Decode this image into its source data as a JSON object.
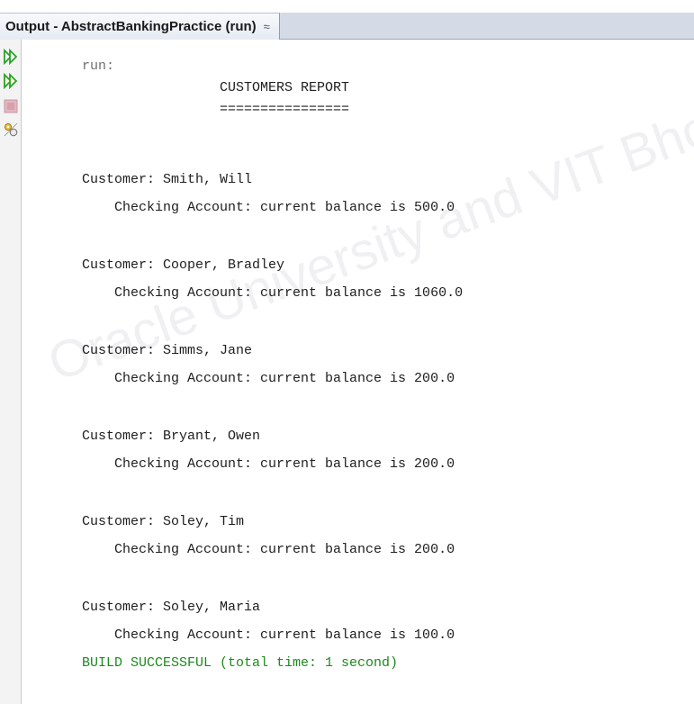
{
  "top_strip_text": "",
  "tab": {
    "title": "Output - AbstractBankingPractice (run)",
    "close_icon": "close-icon"
  },
  "toolbar": {
    "buttons": [
      {
        "name": "rerun-icon",
        "color": "#2aa12a"
      },
      {
        "name": "rerun-with-options-icon",
        "color": "#2aa12a"
      },
      {
        "name": "stop-icon",
        "color": "#d08a9a"
      },
      {
        "name": "settings-icon",
        "color": "#c8a23a"
      }
    ]
  },
  "output": {
    "lines": [
      {
        "text": "run:",
        "kind": "run"
      },
      {
        "text": "                 CUSTOMERS REPORT",
        "kind": "normal"
      },
      {
        "text": "                 ================",
        "kind": "normal"
      },
      {
        "text": "",
        "kind": "normal"
      },
      {
        "text": "Customer: Smith, Will",
        "kind": "normal"
      },
      {
        "text": "    Checking Account: current balance is 500.0",
        "kind": "normal"
      },
      {
        "text": "",
        "kind": "normal"
      },
      {
        "text": "Customer: Cooper, Bradley",
        "kind": "normal"
      },
      {
        "text": "    Checking Account: current balance is 1060.0",
        "kind": "normal"
      },
      {
        "text": "",
        "kind": "normal"
      },
      {
        "text": "Customer: Simms, Jane",
        "kind": "normal"
      },
      {
        "text": "    Checking Account: current balance is 200.0",
        "kind": "normal"
      },
      {
        "text": "",
        "kind": "normal"
      },
      {
        "text": "Customer: Bryant, Owen",
        "kind": "normal"
      },
      {
        "text": "    Checking Account: current balance is 200.0",
        "kind": "normal"
      },
      {
        "text": "",
        "kind": "normal"
      },
      {
        "text": "Customer: Soley, Tim",
        "kind": "normal"
      },
      {
        "text": "    Checking Account: current balance is 200.0",
        "kind": "normal"
      },
      {
        "text": "",
        "kind": "normal"
      },
      {
        "text": "Customer: Soley, Maria",
        "kind": "normal"
      },
      {
        "text": "    Checking Account: current balance is 100.0",
        "kind": "normal"
      },
      {
        "text": "BUILD SUCCESSFUL (total time: 1 second)",
        "kind": "success"
      }
    ]
  },
  "watermark": "Oracle University and VIT Bhopal U",
  "colors": {
    "success": "#1b8a1b",
    "tab_bar": "#d4dbe6"
  }
}
